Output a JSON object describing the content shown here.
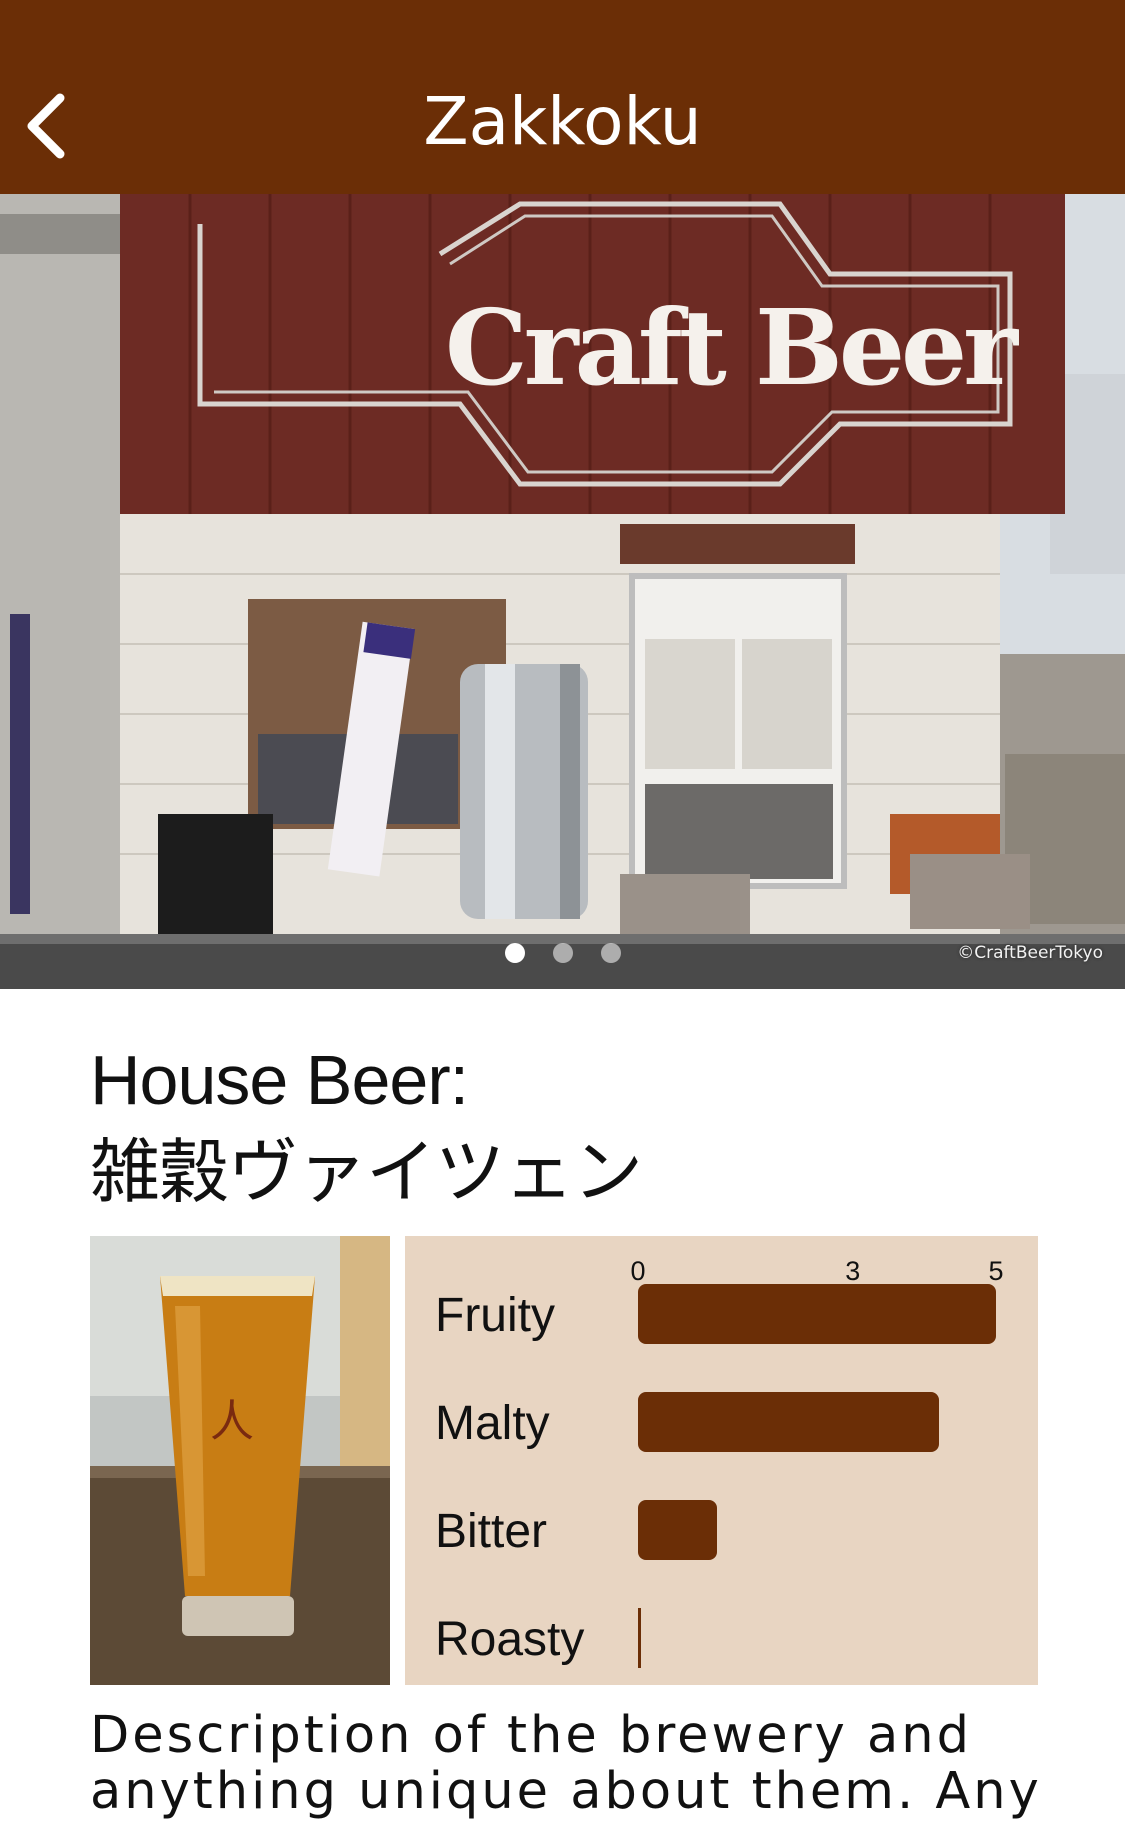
{
  "nav": {
    "title": "Zakkoku",
    "back_icon": "chevron-left-icon"
  },
  "gallery": {
    "watermark": "©CraftBeerTokyo",
    "sign_text": "Craft Beer",
    "page_count": 3,
    "active_page": 1
  },
  "beer": {
    "title_line1": "House Beer:",
    "title_line2": "雑穀ヴァイツェン"
  },
  "profile": {
    "scale_min": 0,
    "scale_max": 5,
    "ticks": [
      "0",
      "3",
      "5"
    ],
    "tick_values": [
      0,
      3,
      5
    ],
    "attributes": [
      {
        "label": "Fruity",
        "value": 5
      },
      {
        "label": "Malty",
        "value": 4.2
      },
      {
        "label": "Bitter",
        "value": 1.1
      },
      {
        "label": "Roasty",
        "value": 0
      }
    ]
  },
  "description": "Description of the brewery and anything unique about them. Any",
  "colors": {
    "brand": "#6b2e06",
    "profile_background": "#e8d5c2"
  }
}
